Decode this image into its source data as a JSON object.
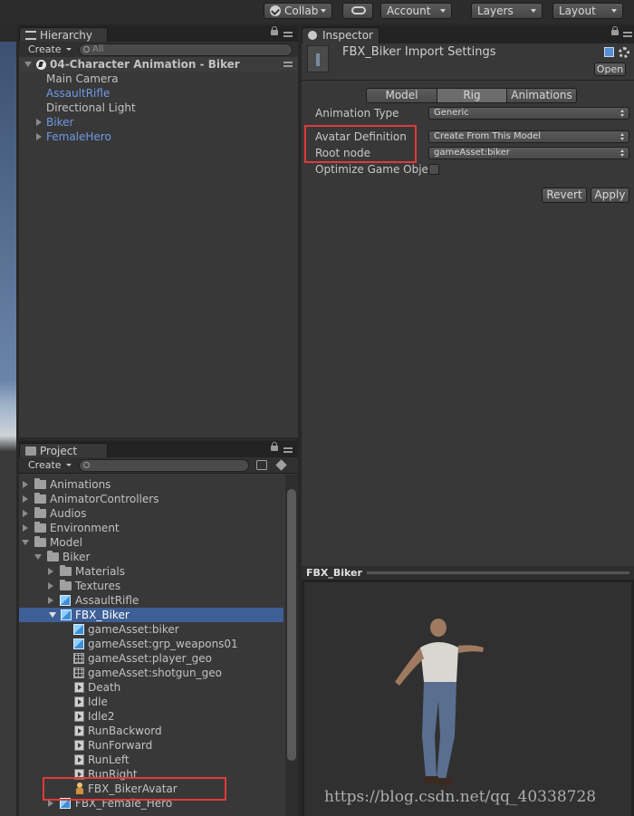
{
  "toolbar": {
    "collab_label": "Collab",
    "account_label": "Account",
    "layers_label": "Layers",
    "layout_label": "Layout"
  },
  "hierarchy": {
    "tab_label": "Hierarchy",
    "create_label": "Create",
    "search_placeholder": "All",
    "scene_name": "04-Character Animation - Biker",
    "items": [
      {
        "label": "Main Camera"
      },
      {
        "label": "AssaultRifle"
      },
      {
        "label": "Directional Light"
      },
      {
        "label": "Biker"
      },
      {
        "label": "FemaleHero"
      }
    ]
  },
  "project": {
    "tab_label": "Project",
    "create_label": "Create",
    "items": [
      {
        "label": "Animations"
      },
      {
        "label": "AnimatorControllers"
      },
      {
        "label": "Audios"
      },
      {
        "label": "Environment"
      },
      {
        "label": "Model"
      },
      {
        "label": "Biker"
      },
      {
        "label": "Materials"
      },
      {
        "label": "Textures"
      },
      {
        "label": "AssaultRifle"
      },
      {
        "label": "FBX_Biker"
      },
      {
        "label": "gameAsset:biker"
      },
      {
        "label": "gameAsset:grp_weapons01"
      },
      {
        "label": "gameAsset:player_geo"
      },
      {
        "label": "gameAsset:shotgun_geo"
      },
      {
        "label": "Death"
      },
      {
        "label": "Idle"
      },
      {
        "label": "Idle2"
      },
      {
        "label": "RunBackword"
      },
      {
        "label": "RunForward"
      },
      {
        "label": "RunLeft"
      },
      {
        "label": "RunRight"
      },
      {
        "label": "FBX_BikerAvatar"
      },
      {
        "label": "FBX_Female_Hero"
      }
    ]
  },
  "inspector": {
    "tab_label": "Inspector",
    "title": "FBX_Biker Import Settings",
    "open_label": "Open",
    "tabs": [
      {
        "label": "Model"
      },
      {
        "label": "Rig"
      },
      {
        "label": "Animations"
      }
    ],
    "active_tab": "Rig",
    "properties": {
      "animation_type_label": "Animation Type",
      "animation_type_value": "Generic",
      "avatar_definition_label": "Avatar Definition",
      "avatar_definition_value": "Create From This Model",
      "root_node_label": "Root node",
      "root_node_value": "gameAsset:biker",
      "optimize_label": "Optimize Game Objec"
    },
    "revert_label": "Revert",
    "apply_label": "Apply"
  },
  "preview": {
    "title": "FBX_Biker"
  },
  "watermark": "https://blog.csdn.net/qq_40338728",
  "colors": {
    "background": "#282828",
    "panel": "#383838",
    "selection": "#3e5f96",
    "link_blue": "#6f9ae6",
    "highlight_red": "#e03a3a"
  }
}
